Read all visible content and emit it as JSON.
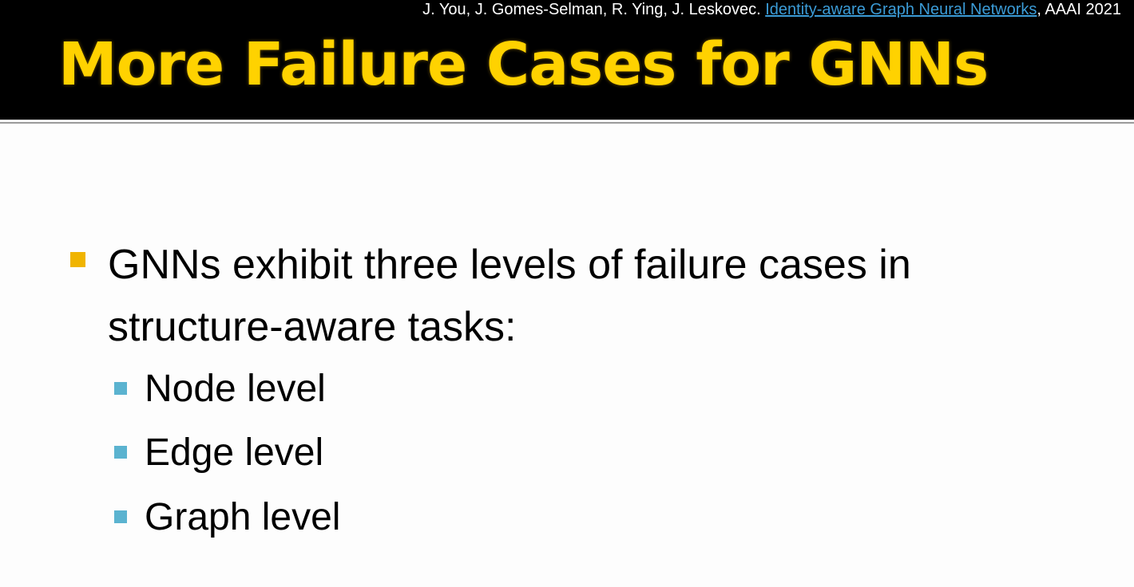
{
  "header": {
    "citation_authors": "J. You, J. Gomes-Selman, R. Ying, J. Leskovec.",
    "citation_link": "Identity-aware Graph Neural Networks",
    "citation_venue": ", AAAI 2021",
    "title": "More Failure Cases for GNNs"
  },
  "content": {
    "main_bullet": "GNNs exhibit three levels of failure cases in structure-aware tasks:",
    "sub_bullets": [
      "Node level",
      "Edge level",
      "Graph level"
    ]
  },
  "colors": {
    "title": "#ffd200",
    "header_background": "#000000",
    "main_bullet": "#f0b400",
    "sub_bullet": "#5bb3d0",
    "link": "#3b9bd6"
  }
}
